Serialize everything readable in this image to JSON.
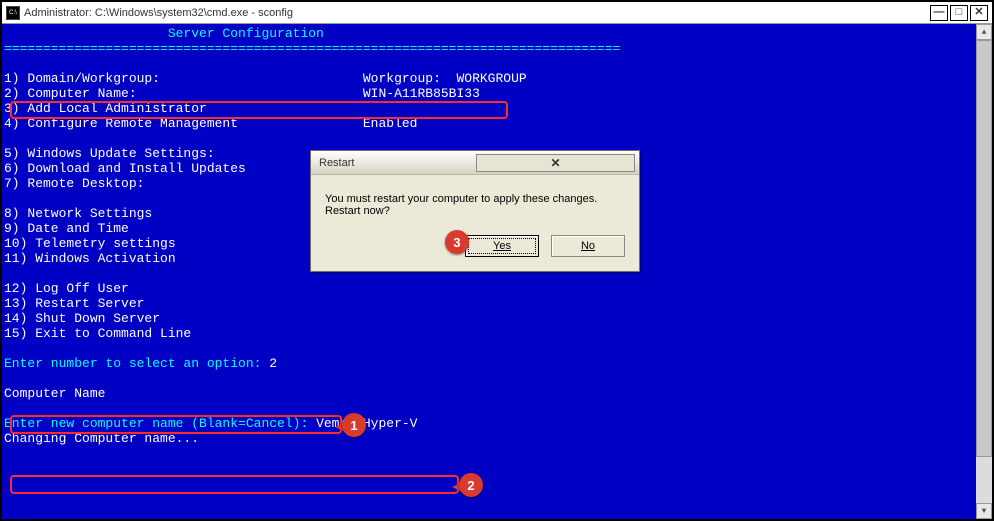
{
  "window": {
    "title": "Administrator: C:\\Windows\\system32\\cmd.exe - sconfig",
    "min": "—",
    "max": "□",
    "close": "✕"
  },
  "header": {
    "title": "Server Configuration",
    "rule": "==============================================================================="
  },
  "menu": [
    {
      "label": "1) Domain/Workgroup:",
      "value": "Workgroup:  WORKGROUP"
    },
    {
      "label": "2) Computer Name:",
      "value": "WIN-A11RB85BI33"
    },
    {
      "label": "3) Add Local Administrator",
      "value": ""
    },
    {
      "label": "4) Configure Remote Management",
      "value": "Enabled"
    },
    {
      "label": "",
      "value": ""
    },
    {
      "label": "5) Windows Update Settings:",
      "value": ""
    },
    {
      "label": "6) Download and Install Updates",
      "value": ""
    },
    {
      "label": "7) Remote Desktop:",
      "value": ""
    },
    {
      "label": "",
      "value": ""
    },
    {
      "label": "8) Network Settings",
      "value": ""
    },
    {
      "label": "9) Date and Time",
      "value": ""
    },
    {
      "label": "10) Telemetry settings",
      "value": ""
    },
    {
      "label": "11) Windows Activation",
      "value": ""
    },
    {
      "label": "",
      "value": ""
    },
    {
      "label": "12) Log Off User",
      "value": ""
    },
    {
      "label": "13) Restart Server",
      "value": ""
    },
    {
      "label": "14) Shut Down Server",
      "value": ""
    },
    {
      "label": "15) Exit to Command Line",
      "value": ""
    }
  ],
  "prompts": {
    "select_prompt": "Enter number to select an option: ",
    "select_value": "2",
    "section": "Computer Name",
    "name_prompt": "Enter new computer name (Blank=Cancel): ",
    "name_value": "Vembu-Hyper-V",
    "changing": "Changing Computer name..."
  },
  "dialog": {
    "title": "Restart",
    "body1": "You must restart your computer to apply these changes.",
    "body2": "Restart now?",
    "yes": "Yes",
    "no": "No",
    "close": "✕"
  },
  "callouts": {
    "c1": "1",
    "c2": "2",
    "c3": "3"
  }
}
